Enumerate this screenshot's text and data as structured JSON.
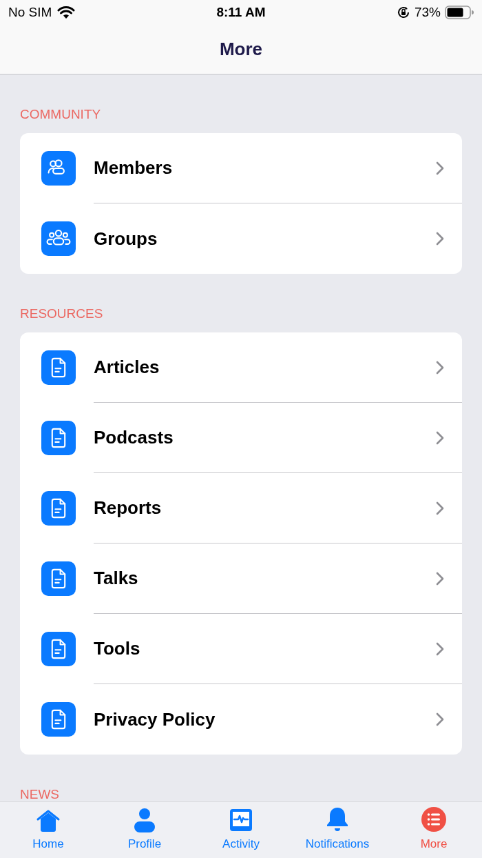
{
  "status_bar": {
    "carrier": "No SIM",
    "time": "8:11 AM",
    "battery": "73%"
  },
  "nav": {
    "title": "More"
  },
  "sections": [
    {
      "title": "COMMUNITY",
      "items": [
        {
          "label": "Members",
          "kind": "people"
        },
        {
          "label": "Groups",
          "kind": "group"
        }
      ]
    },
    {
      "title": "RESOURCES",
      "items": [
        {
          "label": "Articles",
          "kind": "document"
        },
        {
          "label": "Podcasts",
          "kind": "document"
        },
        {
          "label": "Reports",
          "kind": "document"
        },
        {
          "label": "Talks",
          "kind": "document"
        },
        {
          "label": "Tools",
          "kind": "document"
        },
        {
          "label": "Privacy Policy",
          "kind": "document"
        }
      ]
    },
    {
      "title": "NEWS"
    }
  ],
  "tabs": [
    {
      "label": "Home",
      "kind": "home",
      "selected": false
    },
    {
      "label": "Profile",
      "kind": "person",
      "selected": false
    },
    {
      "label": "Activity",
      "kind": "activity",
      "selected": false
    },
    {
      "label": "Notifications",
      "kind": "bell",
      "selected": false
    },
    {
      "label": "More",
      "kind": "list",
      "selected": true
    }
  ]
}
